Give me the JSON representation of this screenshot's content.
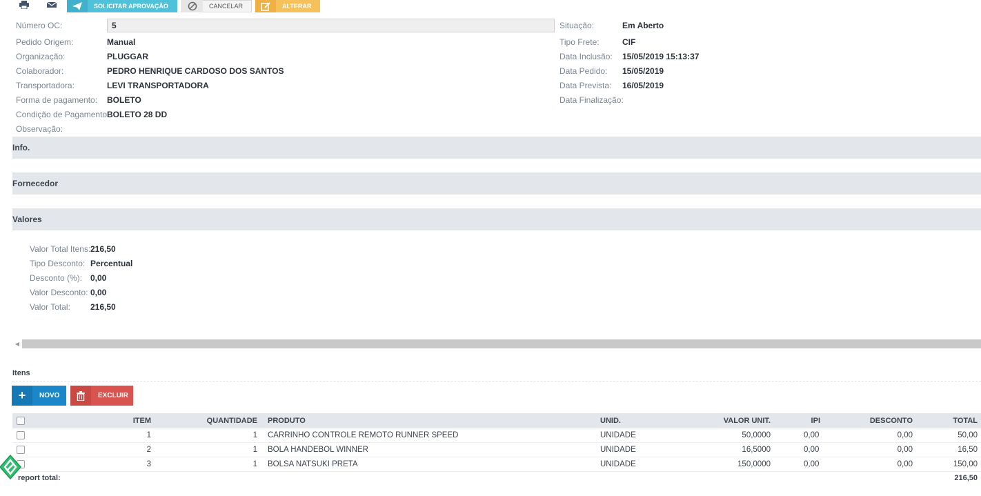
{
  "toolbar": {
    "print_icon": "printer-icon",
    "email_icon": "envelope-icon",
    "approve_label": "SOLICITAR APROVAÇÃO",
    "cancel_label": "CANCELAR",
    "alter_label": "ALTERAR",
    "colors": {
      "approve": "#4fc1d9",
      "alter": "#f6c05a"
    }
  },
  "header": {
    "numero_oc": {
      "label": "Número OC:",
      "value": "5"
    },
    "pedido_origem": {
      "label": "Pedido Origem:",
      "value": "Manual"
    },
    "organizacao": {
      "label": "Organização:",
      "value": "PLUGGAR"
    },
    "colaborador": {
      "label": "Colaborador:",
      "value": "PEDRO HENRIQUE CARDOSO DOS SANTOS"
    },
    "transportadora": {
      "label": "Transportadora:",
      "value": "LEVI TRANSPORTADORA"
    },
    "forma_pagamento": {
      "label": "Forma de pagamento:",
      "value": "BOLETO"
    },
    "condicao_pagamento": {
      "label": "Condição de Pagamento:",
      "value": "BOLETO 28 DD"
    },
    "observacao": {
      "label": "Observação:",
      "value": ""
    },
    "situacao": {
      "label": "Situação:",
      "value": "Em Aberto"
    },
    "tipo_frete": {
      "label": "Tipo Frete:",
      "value": "CIF"
    },
    "data_inclusao": {
      "label": "Data Inclusão:",
      "value": "15/05/2019 15:13:37"
    },
    "data_pedido": {
      "label": "Data Pedido:",
      "value": "15/05/2019"
    },
    "data_prevista": {
      "label": "Data Prevista:",
      "value": "16/05/2019"
    },
    "data_finalizacao": {
      "label": "Data Finalização:",
      "value": ""
    }
  },
  "sections": {
    "info": "Info.",
    "fornecedor": "Fornecedor",
    "valores": "Valores"
  },
  "valores": {
    "valor_total_itens": {
      "label": "Valor Total Itens:",
      "value": "216,50"
    },
    "tipo_desconto": {
      "label": "Tipo Desconto:",
      "value": "Percentual"
    },
    "desconto_pct": {
      "label": "Desconto (%):",
      "value": "0,00"
    },
    "valor_desconto": {
      "label": "Valor Desconto:",
      "value": "0,00"
    },
    "valor_total": {
      "label": "Valor Total:",
      "value": "216,50"
    }
  },
  "itens": {
    "title": "Itens",
    "novo_label": "NOVO",
    "excluir_label": "EXCLUIR",
    "columns": [
      "ITEM",
      "QUANTIDADE",
      "PRODUTO",
      "UNID.",
      "VALOR UNIT.",
      "IPI",
      "DESCONTO",
      "TOTAL"
    ],
    "rows": [
      {
        "item": "1",
        "quantidade": "1",
        "produto": "CARRINHO CONTROLE REMOTO RUNNER SPEED",
        "unid": "UNIDADE",
        "valor_unit": "50,0000",
        "ipi": "0,00",
        "desconto": "0,00",
        "total": "50,00"
      },
      {
        "item": "2",
        "quantidade": "1",
        "produto": "BOLA HANDEBOL WINNER",
        "unid": "UNIDADE",
        "valor_unit": "16,5000",
        "ipi": "0,00",
        "desconto": "0,00",
        "total": "16,50"
      },
      {
        "item": "3",
        "quantidade": "1",
        "produto": "BOLSA NATSUKI PRETA",
        "unid": "UNIDADE",
        "valor_unit": "150,0000",
        "ipi": "0,00",
        "desconto": "0,00",
        "total": "150,00"
      }
    ],
    "report_total_label": "report total:",
    "report_total_value": "216,50"
  }
}
